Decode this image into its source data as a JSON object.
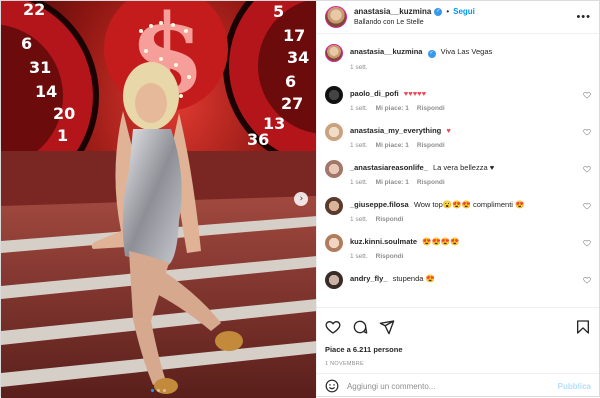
{
  "post": {
    "author": "anastasia__kuzmina",
    "follow_label": "Segui",
    "location": "Ballando con Le Stelle",
    "more_label": "•••",
    "carousel": {
      "slides": 3,
      "active": 1
    }
  },
  "caption": {
    "username": "anastasia__kuzmina",
    "text": "Viva Las Vegas",
    "time": "1 sett."
  },
  "comments": [
    {
      "username": "paolo_di_pofi",
      "text": "♥♥♥♥♥",
      "time": "1 sett.",
      "likes": "Mi piace: 1",
      "reply": "Rispondi"
    },
    {
      "username": "anastasia_my_everything",
      "text": "♥",
      "time": "1 sett.",
      "likes": "Mi piace: 1",
      "reply": "Rispondi"
    },
    {
      "username": "_anastasiareasonlife_",
      "text": "La vera bellezza ♥",
      "time": "1 sett.",
      "likes": "Mi piace: 1",
      "reply": "Rispondi"
    },
    {
      "username": "_giuseppe.filosa",
      "text": "Wow top😮😍😍 complimenti 😍",
      "time": "1 sett.",
      "likes": "",
      "reply": "Rispondi"
    },
    {
      "username": "kuz.kinni.soulmate",
      "text": "😍😍😍😍",
      "time": "1 sett.",
      "likes": "",
      "reply": "Rispondi"
    },
    {
      "username": "andry_fly_",
      "text": "stupenda 😍",
      "time": "",
      "likes": "",
      "reply": ""
    }
  ],
  "stats": {
    "likes_text": "Piace a 6.211 persone",
    "date": "1 NOVEMBRE"
  },
  "comment_box": {
    "placeholder": "Aggiungi un commento...",
    "post_label": "Pubblica"
  },
  "icons": {
    "like": "heart-icon",
    "comment": "comment-icon",
    "share": "share-icon",
    "save": "bookmark-icon",
    "emoji": "emoji-icon",
    "verified": "verified-badge-icon",
    "next": "chevron-right-icon"
  },
  "colors": {
    "link": "#0095f6",
    "verified": "#3897f0",
    "heart": "#ed4956",
    "muted": "#8e8e8e",
    "carousel_active": "#1ea1f7"
  }
}
